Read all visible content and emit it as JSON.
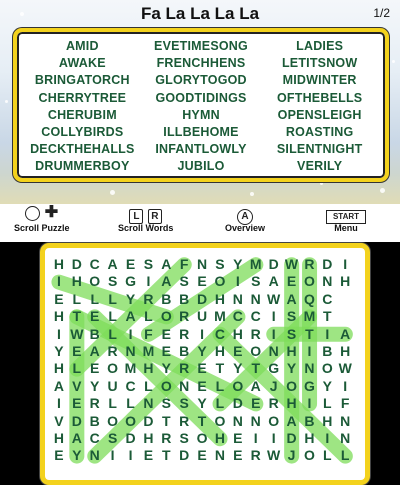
{
  "header": {
    "title": "Fa La La La La",
    "page": "1/2"
  },
  "words": [
    "AMID",
    "AWAKE",
    "BRINGATORCH",
    "CHERRYTREE",
    "CHERUBIM",
    "COLLYBIRDS",
    "DECKTHEHALLS",
    "DRUMMERBOY",
    "EVETIMESONG",
    "FRENCHHENS",
    "GLORYTOGOD",
    "GOODTIDINGS",
    "HYMN",
    "ILLBEHOME",
    "INFANTLOWLY",
    "JUBILO",
    "LADIES",
    "LETITSNOW",
    "MIDWINTER",
    "OFTHEBELLS",
    "OPENSLEIGH",
    "ROASTING",
    "SILENTNIGHT",
    "VERILY"
  ],
  "toolbar": {
    "scroll_puzzle": "Scroll Puzzle",
    "scroll_words": "Scroll Words",
    "overview": "Overview",
    "menu": "Menu",
    "key_l": "L",
    "key_r": "R",
    "key_a": "A",
    "key_start": "START"
  },
  "grid": [
    "HDCAESAFNSYMDWRDI",
    "IHOSGIASEOISAEONH",
    "ELLLYRBBDHNNWAQC",
    "HTELALORUMCCISMT",
    "IWBLIFERICHRISTIA",
    "YEARNMEBYHEONHIBH",
    "HLEOMHYRETYTGYNOW",
    "AVYUCLONELOAJOGYI",
    "IERLLNSSYLDERHILFC",
    "VDBOODTRTONNOABHN",
    "HACSDHRSOHEIIDHIN",
    "EYNIIETDENERWJOLL"
  ],
  "colors": {
    "accent": "#f3d21d",
    "letters": "#1b5a37",
    "highlight": "#7ddc5a"
  }
}
